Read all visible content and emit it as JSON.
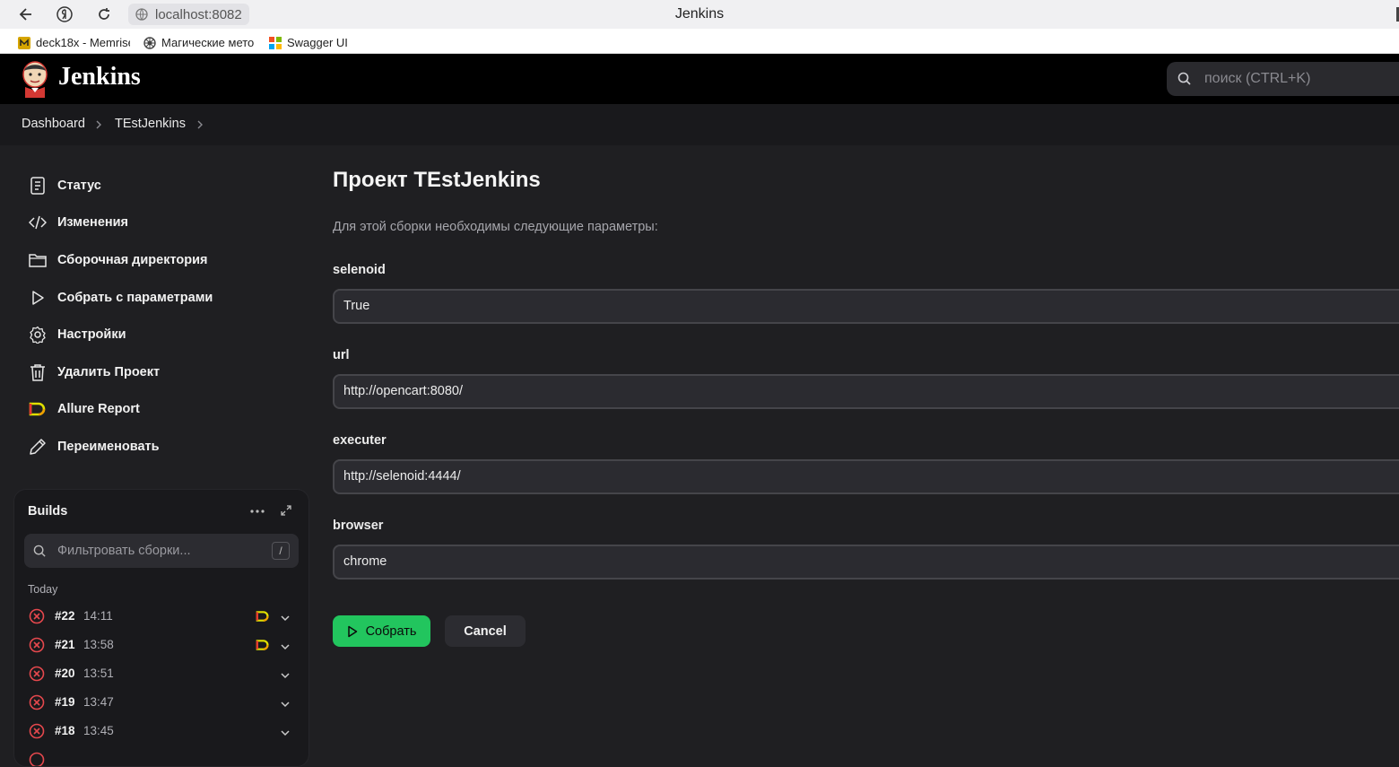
{
  "browser": {
    "url": "localhost:8082",
    "tab_title": "Jenkins",
    "bookmarks": [
      {
        "label": "deck18x - Memrise",
        "icon": "memrise-icon"
      },
      {
        "label": "Магические мето",
        "icon": "gear-wheel-icon"
      },
      {
        "label": "Swagger UI",
        "icon": "swagger-icon"
      }
    ]
  },
  "header": {
    "title": "Jenkins",
    "search_placeholder": "поиск (CTRL+K)"
  },
  "breadcrumb": [
    "Dashboard",
    "TEstJenkins"
  ],
  "sidebar": {
    "items": [
      {
        "label": "Статус",
        "icon": "document-icon"
      },
      {
        "label": "Изменения",
        "icon": "code-icon"
      },
      {
        "label": "Сборочная директория",
        "icon": "folder-icon"
      },
      {
        "label": "Собрать с параметрами",
        "icon": "play-icon"
      },
      {
        "label": "Настройки",
        "icon": "gear-icon"
      },
      {
        "label": "Удалить Проект",
        "icon": "trash-icon"
      },
      {
        "label": "Allure Report",
        "icon": "allure-icon"
      },
      {
        "label": "Переименовать",
        "icon": "pencil-icon"
      }
    ]
  },
  "builds": {
    "title": "Builds",
    "filter_placeholder": "Фильтровать сборки...",
    "filter_shortcut": "/",
    "group": "Today",
    "items": [
      {
        "number": "#22",
        "time": "14:11",
        "status": "failed",
        "allure": true
      },
      {
        "number": "#21",
        "time": "13:58",
        "status": "failed",
        "allure": true
      },
      {
        "number": "#20",
        "time": "13:51",
        "status": "failed",
        "allure": false
      },
      {
        "number": "#19",
        "time": "13:47",
        "status": "failed",
        "allure": false
      },
      {
        "number": "#18",
        "time": "13:45",
        "status": "failed",
        "allure": false
      }
    ]
  },
  "main": {
    "title": "Проект TEstJenkins",
    "description": "Для этой сборки необходимы следующие параметры:",
    "params": [
      {
        "name": "selenoid",
        "value": "True"
      },
      {
        "name": "url",
        "value": "http://opencart:8080/"
      },
      {
        "name": "executer",
        "value": "http://selenoid:4444/"
      },
      {
        "name": "browser",
        "value": "chrome"
      }
    ],
    "build_label": "Собрать",
    "cancel_label": "Cancel"
  },
  "colors": {
    "accent_green": "#22c55e",
    "fail_red": "#e5484d",
    "background": "#1f1f22"
  }
}
